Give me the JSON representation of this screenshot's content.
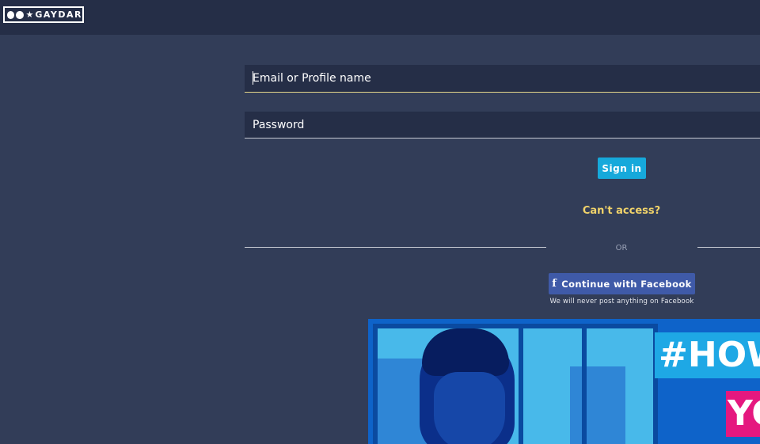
{
  "header": {
    "logo_text": "GAYDAR"
  },
  "login": {
    "email_placeholder": "Email or Profile name",
    "password_placeholder": "Password",
    "signin_label": "Sign in",
    "cant_access_label": "Can't access?",
    "or_label": "OR",
    "facebook_label": "Continue with Facebook",
    "facebook_note": "We will never post anything on Facebook"
  },
  "promo": {
    "tag_line1": "#HOW",
    "tag_line2": "YO"
  },
  "colors": {
    "background": "#323d58",
    "header": "#252e47",
    "signin": "#16a9db",
    "facebook": "#3f5aa8",
    "cant_access": "#f1d36a",
    "promo_magenta": "#e5187f"
  },
  "icons": [
    "facebook-icon",
    "star-icon"
  ]
}
